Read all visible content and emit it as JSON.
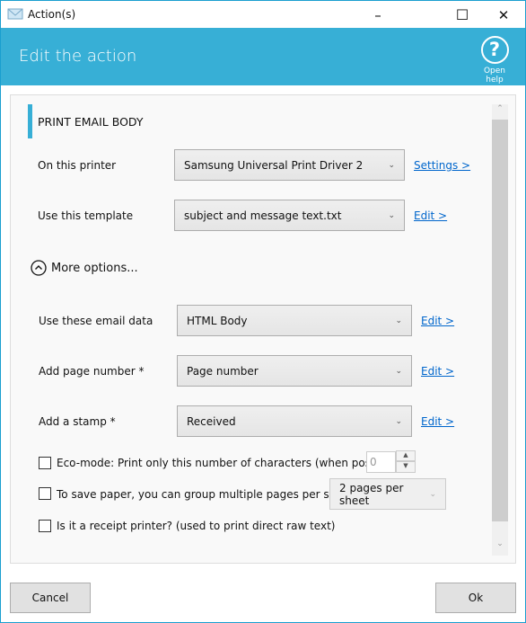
{
  "window": {
    "title": "Action(s)",
    "minimize": "–",
    "maximize": "☐",
    "close": "✕"
  },
  "header": {
    "title": "Edit the action",
    "help_icon": "?",
    "help_label": "Open help",
    "color": "#37afd6"
  },
  "section": {
    "title": "PRINT EMAIL BODY"
  },
  "printer": {
    "label": "On this printer",
    "value": "Samsung Universal Print Driver 2",
    "link": "Settings >"
  },
  "template": {
    "label": "Use this template",
    "value": "subject and message text.txt",
    "link": "Edit >"
  },
  "more_options": {
    "label": "More options..."
  },
  "email_data": {
    "label": "Use these email data",
    "value": "HTML Body",
    "link": "Edit >"
  },
  "page_number": {
    "label": "Add page number *",
    "value": "Page number",
    "link": "Edit >"
  },
  "stamp": {
    "label": "Add a stamp *",
    "value": "Received",
    "link": "Edit >"
  },
  "eco": {
    "label": "Eco-mode: Print only this number of characters (when possible):",
    "value": "0",
    "checked": false
  },
  "group": {
    "label": "To save paper, you can group multiple pages per sheet",
    "value": "2 pages per sheet",
    "checked": false
  },
  "receipt": {
    "label": "Is it a receipt printer? (used to print direct raw text)",
    "checked": false
  },
  "footer": {
    "cancel": "Cancel",
    "ok": "Ok"
  }
}
